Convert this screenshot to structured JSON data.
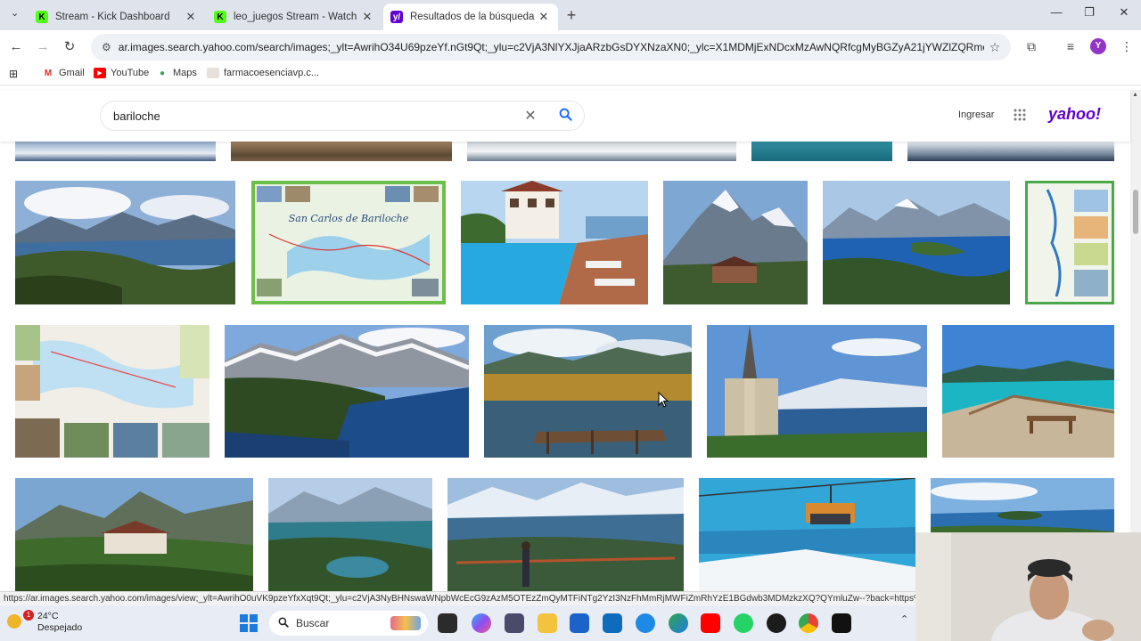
{
  "browser": {
    "tabs": [
      {
        "title": "Stream - Kick Dashboard",
        "favicon": "kick-icon",
        "close": "✕",
        "active": false
      },
      {
        "title": "leo_juegos Stream - Watch Live",
        "favicon": "kick-icon",
        "close": "✕",
        "active": false
      },
      {
        "title": "Resultados de la búsqueda de I",
        "favicon": "yahoo-icon",
        "close": "✕",
        "active": true
      }
    ],
    "new_tab": "+",
    "url": "ar.images.search.yahoo.com/search/images;_ylt=AwrihO34U69pzeYf.nGt9Qt;_ylu=c2VjA3NlYXJjaARzbGsDYXNzaXN0;_ylc=X1MDMjExNDcxMzAwNQRfcgMyBGZyA21jYWZlZQRmcjIDc2Et7...",
    "bookmarks": [
      {
        "label": "Gmail",
        "icon": "gmail-icon"
      },
      {
        "label": "YouTube",
        "icon": "youtube-icon"
      },
      {
        "label": "Maps",
        "icon": "maps-icon"
      },
      {
        "label": "farmacoesenciavp.c...",
        "icon": "page-icon"
      }
    ],
    "status_url": "https://ar.images.search.yahoo.com/images/view;_ylt=AwrihO0uVK9pzeYfxXqt9Qt;_ylu=c2VjA3NyBHNswaWNpbWcEcG9zAzM5OTEzZmQyMTFiNTg2YzI3NzFhMmRjMWFiZmRhYzE1BGdwb3MDMzkzXQ?QYmluZw--?back=https%3A%2F"
  },
  "yahoo": {
    "query": "bariloche",
    "clear_icon": "✕",
    "signin": "Ingresar",
    "logo": "yahoo!"
  },
  "images": {
    "rows": [
      [
        {
          "label": "snowy-landscape"
        },
        {
          "label": "village-view"
        },
        {
          "label": "snow-houses"
        },
        {
          "label": "teal-water"
        },
        {
          "label": "snowy-mountain"
        }
      ],
      [
        {
          "label": "lake-panorama"
        },
        {
          "label": "san-carlos-de-bariloche-map",
          "text": "San Carlos de Bariloche"
        },
        {
          "label": "hotel-pool"
        },
        {
          "label": "llao-llao-hotel-mountain"
        },
        {
          "label": "blue-lakes"
        },
        {
          "label": "park-map"
        }
      ],
      [
        {
          "label": "tourist-map"
        },
        {
          "label": "forest-lake"
        },
        {
          "label": "golden-wetland-pier"
        },
        {
          "label": "cathedral-lake"
        },
        {
          "label": "turquoise-viewpoint"
        }
      ],
      [
        {
          "label": "llao-llao-valley"
        },
        {
          "label": "mountain-lakes"
        },
        {
          "label": "hiker-viewpoint"
        },
        {
          "label": "chairlift-lake"
        },
        {
          "label": "lake-islands"
        }
      ]
    ]
  },
  "taskbar": {
    "weather_temp": "24°C",
    "weather_desc": "Despejado",
    "badge_count": "1",
    "search_placeholder": "Buscar"
  },
  "colors": {
    "yahoo_purple": "#6001d2",
    "search_blue": "#1a66ff",
    "kick_green": "#53fc18"
  }
}
